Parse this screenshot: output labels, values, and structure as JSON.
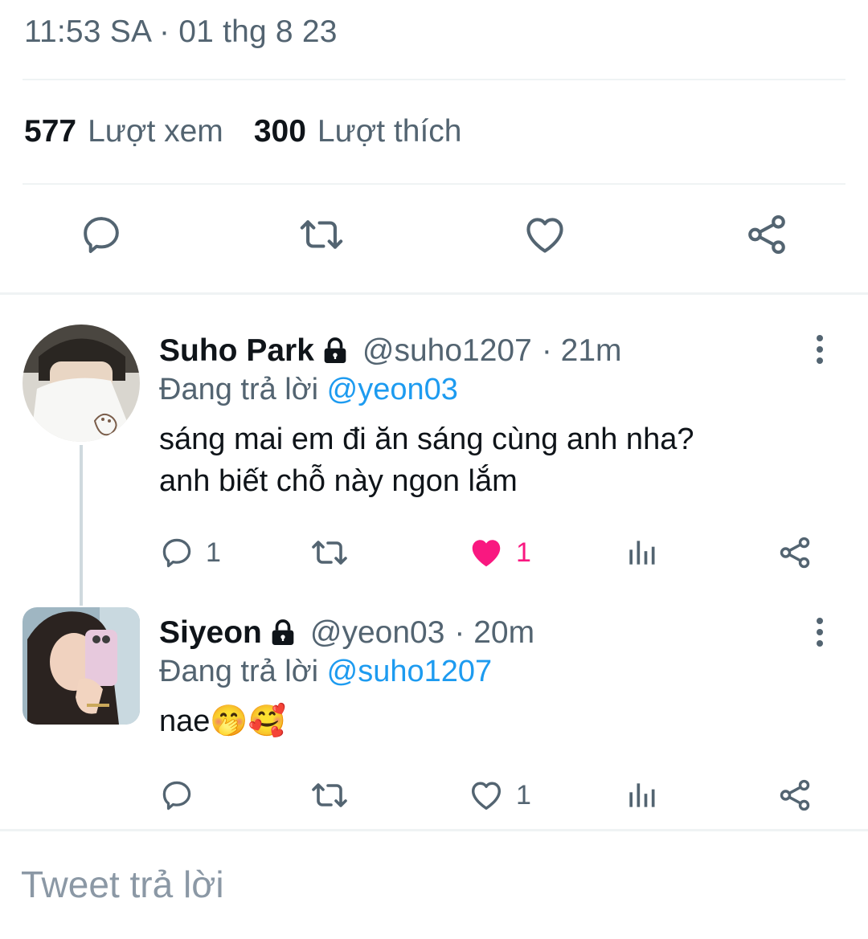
{
  "tweet": {
    "timestamp": "11:53 SA · 01 thg 8 23",
    "views_count": "577",
    "views_label": "Lượt xem",
    "likes_count": "300",
    "likes_label": "Lượt thích"
  },
  "replies": [
    {
      "name": "Suho Park",
      "handle": "@suho1207",
      "time": "· 21m",
      "replying_prefix": "Đang trả lời",
      "replying_to": "@yeon03",
      "text_line1": "sáng mai em đi ăn sáng cùng anh nha?",
      "text_line2": "anh biết chỗ này ngon lắm",
      "reply_count": "1",
      "like_count": "1",
      "liked": true
    },
    {
      "name": "Siyeon",
      "handle": "@yeon03",
      "time": "· 20m",
      "replying_prefix": "Đang trả lời",
      "replying_to": "@suho1207",
      "text": "nae🤭🥰",
      "reply_count": "",
      "like_count": "1",
      "liked": false
    }
  ],
  "compose": {
    "placeholder": "Tweet trả lời"
  },
  "icons": {
    "reply": "speech-bubble-icon",
    "retweet": "retweet-icon",
    "like": "heart-icon",
    "share": "share-icon",
    "analytics": "bar-chart-icon",
    "lock": "lock-icon",
    "more": "vertical-ellipsis-icon"
  },
  "colors": {
    "accent": "#1d9bf0",
    "like": "#f91880",
    "text_secondary": "#536471"
  }
}
